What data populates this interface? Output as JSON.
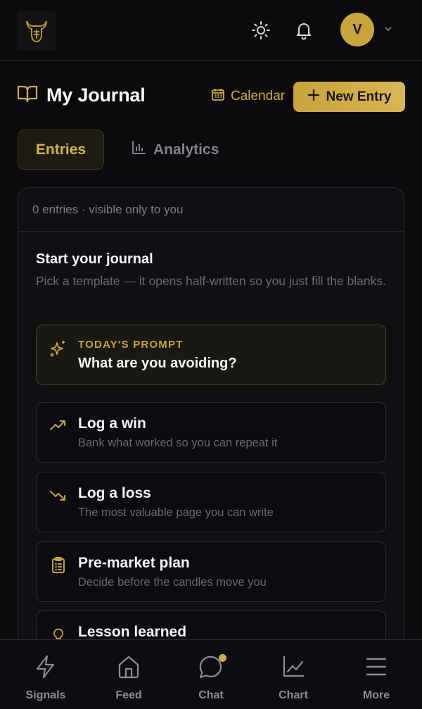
{
  "topbar": {
    "logo_icon": "bull-head-icon",
    "theme_icon": "sun-icon",
    "notifications_icon": "bell-icon",
    "avatar_initial": "V",
    "menu_icon": "chevron-down-icon"
  },
  "header": {
    "title": "My Journal",
    "title_icon": "book-open-icon",
    "calendar_label": "Calendar",
    "new_entry_label": "New Entry"
  },
  "tabs": [
    {
      "label": "Entries",
      "active": true
    },
    {
      "label": "Analytics",
      "active": false,
      "icon": "bar-chart-icon"
    }
  ],
  "card": {
    "meta": "0 entries · visible only to you",
    "start_title": "Start your journal",
    "start_subtitle": "Pick a template — it opens half-written so you just fill the blanks.",
    "prompt": {
      "label": "TODAY'S PROMPT",
      "text": "What are you avoiding?",
      "icon": "sparkles-icon"
    },
    "templates": [
      {
        "title": "Log a win",
        "subtitle": "Bank what worked so you can repeat it",
        "icon": "trending-up-icon"
      },
      {
        "title": "Log a loss",
        "subtitle": "The most valuable page you can write",
        "icon": "trending-down-icon"
      },
      {
        "title": "Pre-market plan",
        "subtitle": "Decide before the candles move you",
        "icon": "clipboard-icon"
      },
      {
        "title": "Lesson learned",
        "subtitle": "",
        "icon": "lightbulb-icon"
      }
    ]
  },
  "nav": [
    {
      "label": "Signals",
      "icon": "zap-icon"
    },
    {
      "label": "Feed",
      "icon": "home-icon"
    },
    {
      "label": "Chat",
      "icon": "chat-bubble-icon",
      "badge": true
    },
    {
      "label": "Chart",
      "icon": "line-chart-icon"
    },
    {
      "label": "More",
      "icon": "menu-icon"
    }
  ],
  "colors": {
    "accent": "#d4ac45",
    "background": "#0b0b0e",
    "card": "#101014"
  }
}
